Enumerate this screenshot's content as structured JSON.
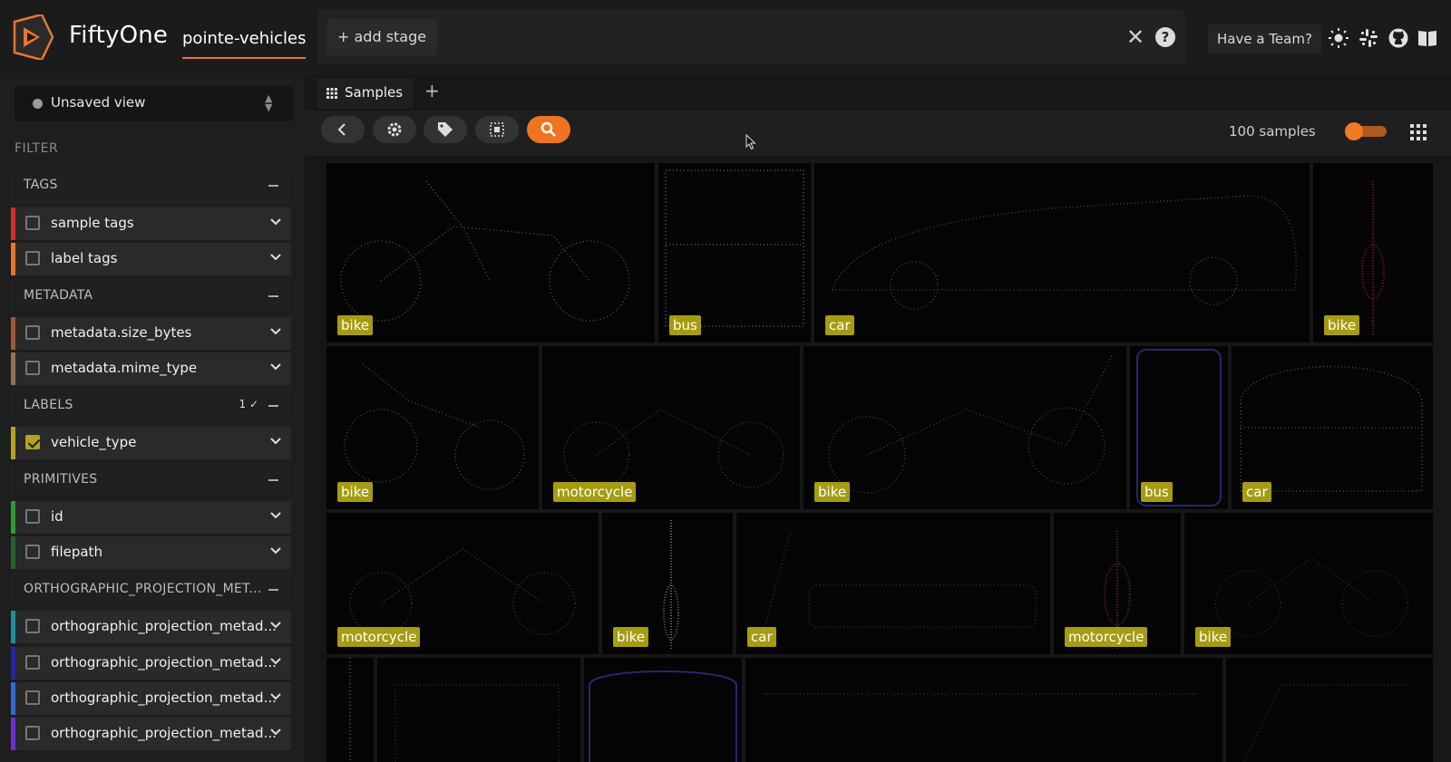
{
  "header": {
    "app_name": "FiftyOne",
    "dataset_name": "pointe-vehicles",
    "add_stage_label": "+ add stage",
    "team_button_label": "Have a Team?",
    "icons": [
      "logo-icon",
      "close-icon",
      "help-icon",
      "sun-icon",
      "slack-icon",
      "github-icon",
      "book-icon"
    ],
    "accent_color": "#ef7420"
  },
  "sidebar": {
    "view_selector_label": "Unsaved view",
    "filter_title": "FILTER",
    "sections": [
      {
        "title": "TAGS",
        "items": [
          {
            "label": "sample tags",
            "checked": false,
            "color": "#d12d2d"
          },
          {
            "label": "label tags",
            "checked": false,
            "color": "#e5762a"
          }
        ]
      },
      {
        "title": "METADATA",
        "items": [
          {
            "label": "metadata.size_bytes",
            "checked": false,
            "color": "#9b5a33"
          },
          {
            "label": "metadata.mime_type",
            "checked": false,
            "color": "#8f7257"
          }
        ]
      },
      {
        "title": "LABELS",
        "badge": "1",
        "items": [
          {
            "label": "vehicle_type",
            "checked": true,
            "color": "#b5a21f"
          }
        ]
      },
      {
        "title": "PRIMITIVES",
        "items": [
          {
            "label": "id",
            "checked": false,
            "color": "#2f9a35"
          },
          {
            "label": "filepath",
            "checked": false,
            "color": "#24622e"
          }
        ]
      },
      {
        "title": "ORTHOGRAPHIC_PROJECTION_MET...",
        "items": [
          {
            "label": "orthographic_projection_metad...",
            "checked": false,
            "color": "#1f8fa0"
          },
          {
            "label": "orthographic_projection_metad...",
            "checked": false,
            "color": "#2624a8"
          },
          {
            "label": "orthographic_projection_metad...",
            "checked": false,
            "color": "#2f6bd6"
          },
          {
            "label": "orthographic_projection_metad...",
            "checked": false,
            "color": "#6a31d2"
          }
        ]
      }
    ]
  },
  "main": {
    "tab_label": "Samples",
    "sample_count": "100 samples",
    "toolbar_icons": [
      "back-icon",
      "settings-icon",
      "tag-icon",
      "select-icon",
      "search-icon"
    ]
  },
  "gallery": {
    "tag_color": "#a59c11",
    "rows": [
      {
        "tiles": [
          "bike",
          "bus",
          "car",
          "bike"
        ]
      },
      {
        "tiles": [
          "bike",
          "motorcycle",
          "bike",
          "bus",
          "car"
        ]
      },
      {
        "tiles": [
          "motorcycle",
          "bike",
          "car",
          "motorcycle",
          "bike"
        ]
      },
      {
        "tiles": [
          "",
          "",
          "",
          "",
          ""
        ]
      }
    ]
  }
}
